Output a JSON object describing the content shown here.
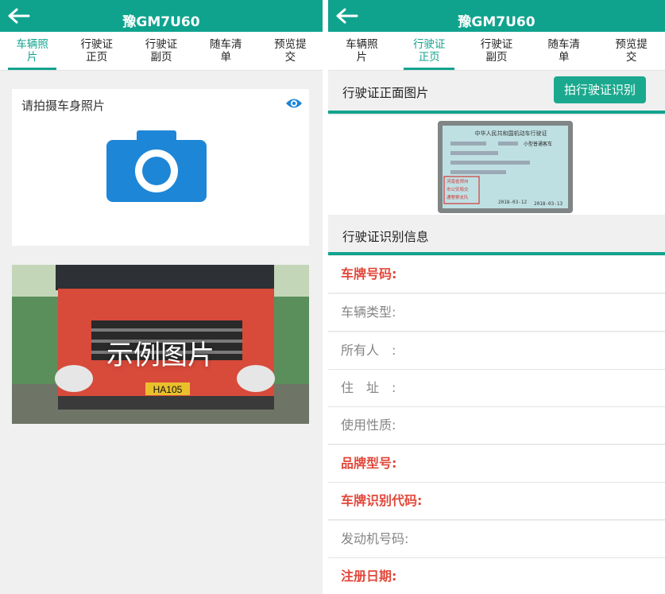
{
  "header": {
    "title": "豫GM7U60"
  },
  "tabs": [
    {
      "label_line1": "车辆照",
      "label_line2": "片"
    },
    {
      "label_line1": "行驶证",
      "label_line2": "正页"
    },
    {
      "label_line1": "行驶证",
      "label_line2": "副页"
    },
    {
      "label_line1": "随车清",
      "label_line2": "单"
    },
    {
      "label_line1": "预览提",
      "label_line2": "交"
    }
  ],
  "left": {
    "active_tab": 0,
    "photo_card_label": "请拍摄车身照片",
    "sample_label": "示例图片",
    "plate_text": "HA105"
  },
  "right": {
    "active_tab": 1,
    "front_image_label": "行驶证正面图片",
    "identify_button": "拍行驶证识别",
    "info_label": "行驶证识别信息",
    "license_card": {
      "title": "中华人民共和国机动车行驶证",
      "vehicle_type": "小型普通客车",
      "stamp_lines": [
        "河南省郑州",
        "市公安局交",
        "通警察支队"
      ],
      "date_registered": "2018-03-12",
      "date_issued": "2018-03-13"
    },
    "fields": [
      {
        "label": "车牌号码:",
        "style": "red"
      },
      {
        "label": " 车辆类型:",
        "style": "grey"
      },
      {
        "label": "所有人　:",
        "style": "grey"
      },
      {
        "label": "住　址　:",
        "style": "grey"
      },
      {
        "label": "使用性质:",
        "style": "grey"
      },
      {
        "label": "品牌型号:",
        "style": "red"
      },
      {
        "label": "车牌识别代码:",
        "style": "red"
      },
      {
        "label": "发动机号码:",
        "style": "grey"
      },
      {
        "label": "注册日期:",
        "style": "red"
      }
    ]
  },
  "colors": {
    "primary": "#0fa38e",
    "accent_red": "#e2473a",
    "camera_blue": "#1e86d6"
  }
}
